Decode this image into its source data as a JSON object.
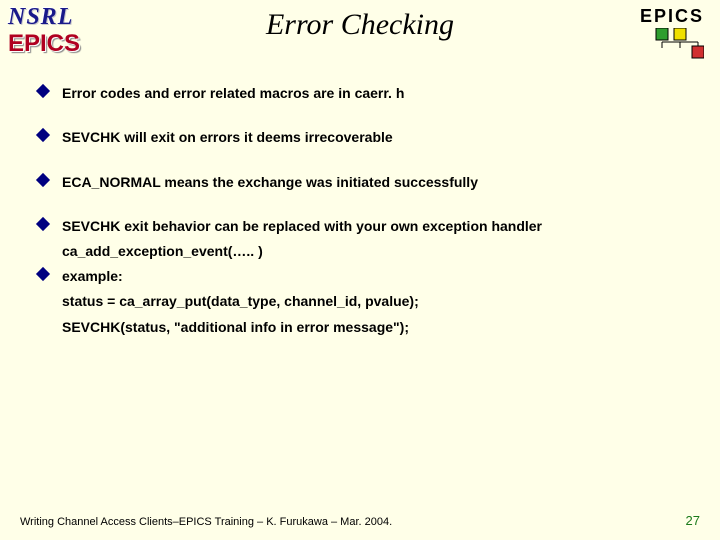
{
  "header": {
    "nsrl": "NSRL",
    "epics_left": "EPICS",
    "title": "Error Checking",
    "epics_right": "EPICS"
  },
  "bullets": {
    "b1": "Error codes and error related macros are in caerr. h",
    "b2": "SEVCHK will exit on errors it deems irrecoverable",
    "b3": "ECA_NORMAL means the exchange was initiated successfully",
    "b4": "SEVCHK exit behavior can be replaced with your own exception handler",
    "b4_sub1": "ca_add_exception_event(….. )",
    "b5": "example:",
    "b5_sub1": "status = ca_array_put(data_type, channel_id, pvalue);",
    "b5_sub2": "SEVCHK(status, \"additional info in error message\");"
  },
  "footer": {
    "text": "Writing Channel Access Clients–EPICS Training – K. Furukawa – Mar. 2004.",
    "page": "27"
  },
  "colors": {
    "logo_green": "#2E9E2E",
    "logo_yellow": "#F0E000",
    "logo_red": "#D03030"
  }
}
